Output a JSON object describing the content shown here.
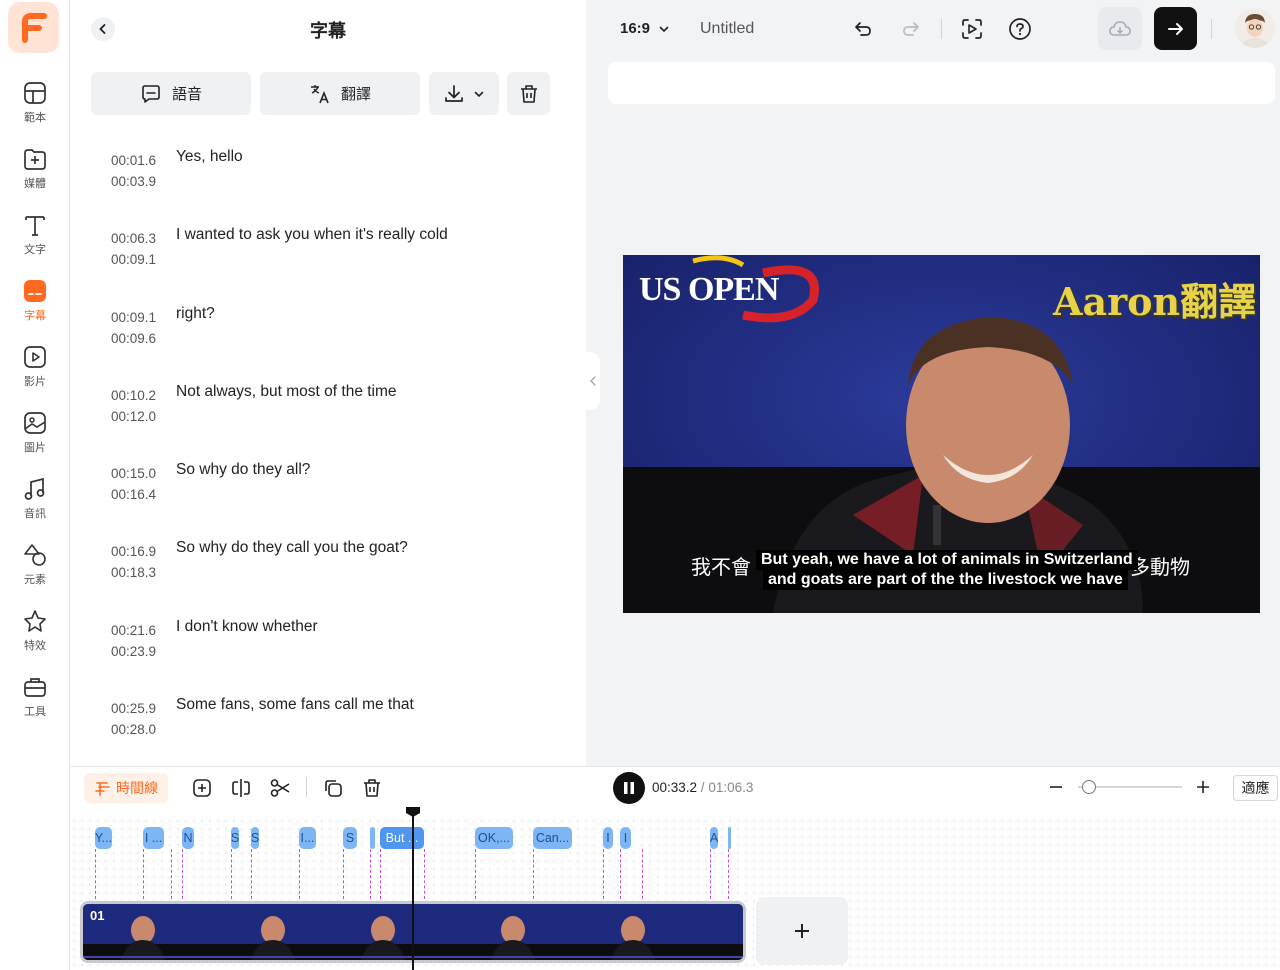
{
  "rail": {
    "items": [
      {
        "label": "範本",
        "icon": "template-icon"
      },
      {
        "label": "媒體",
        "icon": "media-icon"
      },
      {
        "label": "文字",
        "icon": "text-icon"
      },
      {
        "label": "字幕",
        "icon": "subtitle-icon",
        "active": true
      },
      {
        "label": "影片",
        "icon": "video-icon"
      },
      {
        "label": "圖片",
        "icon": "image-icon"
      },
      {
        "label": "音訊",
        "icon": "music-icon"
      },
      {
        "label": "元素",
        "icon": "elements-icon"
      },
      {
        "label": "特效",
        "icon": "effects-icon"
      },
      {
        "label": "工具",
        "icon": "tools-icon"
      }
    ]
  },
  "panel": {
    "title": "字幕",
    "voice_label": "語音",
    "translate_label": "翻譯",
    "subtitles": [
      {
        "start": "00:01.6",
        "end": "00:03.9",
        "text": "Yes, hello"
      },
      {
        "start": "00:06.3",
        "end": "00:09.1",
        "text": "I wanted to ask you when it's really cold"
      },
      {
        "start": "00:09.1",
        "end": "00:09.6",
        "text": "right?"
      },
      {
        "start": "00:10.2",
        "end": "00:12.0",
        "text": "Not always, but most of the time"
      },
      {
        "start": "00:15.0",
        "end": "00:16.4",
        "text": "So why do they all?"
      },
      {
        "start": "00:16.9",
        "end": "00:18.3",
        "text": "So why do they call you the goat?"
      },
      {
        "start": "00:21.6",
        "end": "00:23.9",
        "text": "I don't know whether"
      },
      {
        "start": "00:25.9",
        "end": "00:28.0",
        "text": "Some fans, some fans call me that"
      }
    ]
  },
  "topbar": {
    "ratio": "16:9",
    "title": "Untitled"
  },
  "preview": {
    "logo_text": "US OPEN",
    "watermark": "Aaron翻譯",
    "caption_cn_left": "我不會",
    "caption_cn_right": "多動物",
    "caption_line1": "But yeah, we have a lot of animals in Switzerland",
    "caption_line2": "and goats are part of the the livestock we have"
  },
  "timeline": {
    "tab_label": "時間線",
    "current_time": "00:33.2",
    "separator": " / ",
    "total_time": "01:06.3",
    "fit_label": "適應",
    "zoom_level": 0.04,
    "clip_label": "01",
    "chips": [
      {
        "text": "Y..."
      },
      {
        "text": "I ..."
      },
      {
        "text": "N"
      },
      {
        "text": "S"
      },
      {
        "text": "S"
      },
      {
        "text": "I..."
      },
      {
        "text": "S"
      },
      {
        "text": ""
      },
      {
        "text": "But ..."
      },
      {
        "text": "OK,..."
      },
      {
        "text": "Can..."
      },
      {
        "text": "I"
      },
      {
        "text": "I"
      },
      {
        "text": "A"
      },
      {
        "text": ""
      }
    ]
  },
  "colors": {
    "accent": "#ff6a20",
    "chip": "#7eb5f5",
    "chip_selected": "#4f96ee",
    "video_bg": "#1d2a7d"
  }
}
